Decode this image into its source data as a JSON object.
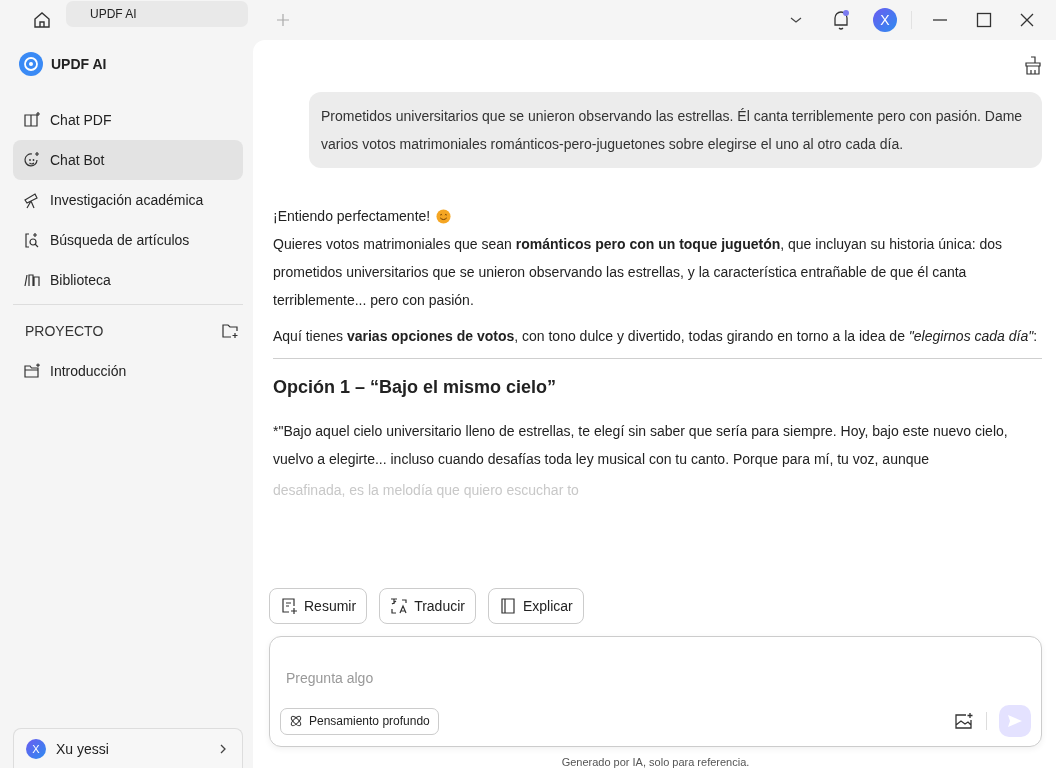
{
  "tabs": [
    {
      "label": "UPDF AI",
      "selected": true
    }
  ],
  "app": {
    "name": "UPDF AI"
  },
  "sidebar": {
    "items": [
      {
        "label": "Chat PDF",
        "kind": "book",
        "selected": false
      },
      {
        "label": "Chat Bot",
        "kind": "bot",
        "selected": true
      },
      {
        "label": "Investigación académica",
        "kind": "telescope",
        "selected": false
      },
      {
        "label": "Búsqueda de artículos",
        "kind": "search",
        "selected": false
      },
      {
        "label": "Biblioteca",
        "kind": "library",
        "selected": false
      }
    ],
    "project": {
      "title": "PROYECTO",
      "items": [
        {
          "label": "Introducción"
        }
      ]
    },
    "user": {
      "initial": "X",
      "name": "Xu yessi"
    }
  },
  "topbar": {
    "avatar": "X",
    "notification": true
  },
  "chat": {
    "user_message": "Prometidos universitarios que se unieron observando las estrellas. Él canta terriblemente pero con pasión. Dame varios votos matrimoniales románticos-pero-juguetones sobre elegirse el uno al otro cada día.",
    "reply": {
      "greeting": "¡Entiendo perfectamente!",
      "paragraphs": [
        "Quieres votos matrimoniales que sean **románticos pero con un toque juguetón**, que incluyan su historia única: dos prometidos universitarios que se unieron observando las estrellas, y la característica entrañable de que él canta terriblemente... pero con pasión.",
        "Aquí tienes **varias opciones de votos**, con tono dulce y divertido, todas girando en torno a la idea de  *\"elegirnos cada día\"*:"
      ],
      "heading": "Opción 1 –  “Bajo el mismo cielo”",
      "vow": "*\"Bajo aquel cielo universitario lleno de estrellas, te elegí sin saber que sería para siempre. Hoy, bajo este nuevo cielo, vuelvo a elegirte... incluso cuando desafías toda ley musical con tu canto. Porque para mí, tu voz, aunque",
      "faded": "desafinada, es la melodía que quiero escuchar to"
    }
  },
  "actions": [
    {
      "label": "Resumir",
      "kind": "summary"
    },
    {
      "label": "Traducir",
      "kind": "translate"
    },
    {
      "label": "Explicar",
      "kind": "book"
    }
  ],
  "input": {
    "placeholder": "Pregunta algo",
    "deep_thinking": {
      "label": "Pensamiento profundo",
      "on": false
    }
  },
  "footer": "Generado por IA, solo para referencia."
}
